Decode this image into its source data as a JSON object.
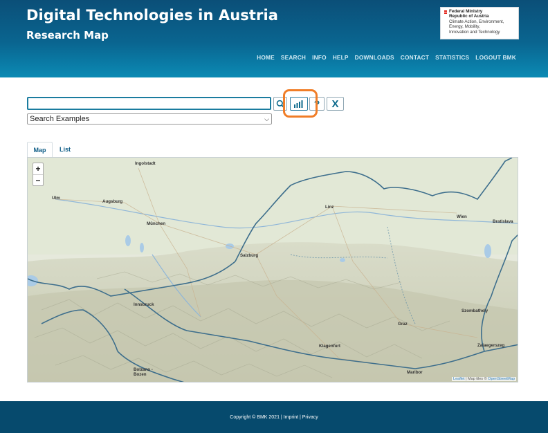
{
  "header": {
    "title": "Digital Technologies in Austria",
    "subtitle": "Research Map",
    "logo": {
      "line1": "Federal Ministry",
      "line2": "Republic of Austria",
      "line3": "Climate Action, Environment,",
      "line4": "Energy, Mobility,",
      "line5": "Innovation and Technology"
    },
    "nav": [
      "HOME",
      "SEARCH",
      "INFO",
      "HELP",
      "DOWNLOADS",
      "CONTACT",
      "STATISTICS",
      "LOGOUT BMK"
    ]
  },
  "search": {
    "value": "",
    "placeholder": "",
    "select_value": "Search Examples"
  },
  "buttons": {
    "search_icon": "search-icon",
    "stats_icon": "bar-chart-icon",
    "help_label": "?",
    "clear_label": "X"
  },
  "tabs": [
    {
      "label": "Map",
      "active": true
    },
    {
      "label": "List",
      "active": false
    }
  ],
  "map": {
    "zoom_in": "+",
    "zoom_out": "−",
    "cities": [
      "Ingolstadt",
      "Ulm",
      "Augsburg",
      "München",
      "Linz",
      "Wien",
      "Bratislava",
      "Salzburg",
      "Innsbruck",
      "Szombathely",
      "Graz",
      "Zalaegerszeg",
      "Klagenfurt",
      "Bolzano - Bozen",
      "Maribor"
    ],
    "attribution_prefix": "Leaflet",
    "attribution_mid": " | Map tiles © ",
    "attribution_link": "OpenStreetMap"
  },
  "footer": {
    "text": "Copyright © BMK 2021 | Imprint | Privacy"
  },
  "colors": {
    "header_top": "#0b4f78",
    "header_bottom": "#0b8ab4",
    "accent": "#1a7c9f",
    "highlight": "#f07d27",
    "footer": "#064a6d"
  }
}
